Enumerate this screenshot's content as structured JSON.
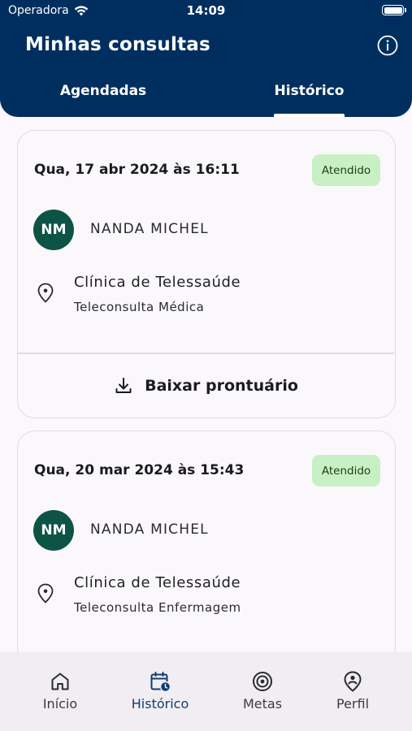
{
  "status_bar": {
    "carrier": "Operadora",
    "time": "14:09"
  },
  "header": {
    "title": "Minhas consultas",
    "tabs": [
      {
        "label": "Agendadas"
      },
      {
        "label": "Histórico"
      }
    ],
    "active_tab": "Histórico"
  },
  "appointments": [
    {
      "date": "Qua, 17 abr 2024 às 16:11",
      "status": "Atendido",
      "initials": "NM",
      "professional": "NANDA MICHEL",
      "clinic": "Clínica de Telessaúde",
      "service": "Teleconsulta Médica",
      "download_label": "Baixar prontuário"
    },
    {
      "date": "Qua, 20 mar 2024 às 15:43",
      "status": "Atendido",
      "initials": "NM",
      "professional": "NANDA MICHEL",
      "clinic": "Clínica de Telessaúde",
      "service": "Teleconsulta Enfermagem"
    }
  ],
  "bottom_nav": {
    "items": [
      {
        "label": "Início",
        "icon": "home-icon"
      },
      {
        "label": "Histórico",
        "icon": "calendar-clock-icon"
      },
      {
        "label": "Metas",
        "icon": "target-icon"
      },
      {
        "label": "Perfil",
        "icon": "profile-pin-icon"
      }
    ],
    "active": "Histórico"
  },
  "colors": {
    "header_bg": "#002f5f",
    "badge_bg": "#c9f0c5",
    "avatar_bg": "#0e5446",
    "active_nav": "#0f3d73"
  }
}
